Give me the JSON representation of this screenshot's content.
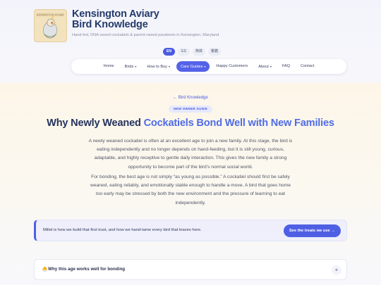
{
  "brand": {
    "logo_text": "KENSINGTON AVIARY",
    "title_line1": "Kensington Aviary",
    "title_line2": "Bird Knowledge",
    "tagline": "Hand-fed, DNA-sexed cockatiels & parent-raised parakeets in Kensington, Maryland"
  },
  "languages": [
    {
      "label": "EN",
      "active": true
    },
    {
      "label": "ES",
      "active": false
    },
    {
      "label": "简体",
      "active": false
    },
    {
      "label": "繁體",
      "active": false
    }
  ],
  "nav": [
    {
      "label": "Home",
      "caret": ""
    },
    {
      "label": "Birds",
      "caret": "▾"
    },
    {
      "label": "How to Buy",
      "caret": "▾"
    },
    {
      "label": "Care Guides",
      "caret": "▾"
    },
    {
      "label": "Happy Customers",
      "caret": ""
    },
    {
      "label": "About",
      "caret": "▾"
    },
    {
      "label": "FAQ",
      "caret": ""
    },
    {
      "label": "Contact",
      "caret": ""
    }
  ],
  "article": {
    "back_link": "← Bird Knowledge",
    "badge": "NEW OWNER GUIDE",
    "headline_part1": "Why Newly Weaned ",
    "headline_accent": "Cockatiels Bond Well with New Families",
    "paragraph1": "A newly weaned cockatiel is often at an excellent age to join a new family. At this stage, the bird is eating independently and no longer depends on hand-feeding, but it is still young, curious, adaptable, and highly receptive to gentle daily interaction. This gives the new family a strong opportunity to become part of the bird’s normal social world.",
    "paragraph2": "For bonding, the best age is not simply “as young as possible.” A cockatiel should first be safely weaned, eating reliably, and emotionally stable enough to handle a move. A bird that goes home too early may be stressed by both the new environment and the pressure of learning to eat independently."
  },
  "callout": {
    "text": "Millet is how we build that first trust, and how we hand-tame every bird that leaves here.",
    "button": "See the treats we use →"
  },
  "accordion": {
    "icon": "🐣",
    "title": "Why this age works well for bonding",
    "toggle": "+"
  },
  "colors": {
    "accent": "#4f5fe4",
    "navy": "#25335e",
    "headline_accent": "#4f6ce6"
  }
}
